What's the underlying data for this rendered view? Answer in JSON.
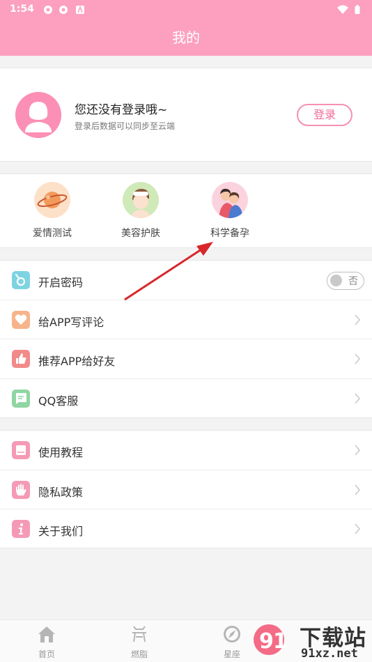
{
  "status": {
    "time": "1:54"
  },
  "header": {
    "title": "我的"
  },
  "profile": {
    "title": "您还没有登录哦~",
    "subtitle": "登录后数据可以同步至云端",
    "login_label": "登录"
  },
  "features": [
    {
      "label": "爱情测试",
      "icon": "planet-icon"
    },
    {
      "label": "美容护肤",
      "icon": "skincare-icon"
    },
    {
      "label": "科学备孕",
      "icon": "couple-icon"
    }
  ],
  "settings": {
    "password": {
      "label": "开启密码",
      "toggle_text": "否",
      "enabled": false
    },
    "review": {
      "label": "给APP写评论"
    },
    "recommend": {
      "label": "推荐APP给好友"
    },
    "qq": {
      "label": "QQ客服"
    },
    "tutorial": {
      "label": "使用教程"
    },
    "privacy": {
      "label": "隐私政策"
    },
    "about": {
      "label": "关于我们"
    }
  },
  "tabs": [
    {
      "label": "首页",
      "icon": "home-icon"
    },
    {
      "label": "燃脂",
      "icon": "fitness-icon"
    },
    {
      "label": "星座",
      "icon": "compass-icon"
    }
  ],
  "watermark": {
    "brand": "下载站",
    "url": "91xz.net"
  },
  "colors": {
    "accent": "#fd9fbf",
    "login_text": "#f06d98",
    "icon_blue": "#7dd3e2",
    "icon_orange": "#f7b48a",
    "icon_red": "#f28a8a",
    "icon_green": "#8fd6a2",
    "icon_pink": "#f59ab6"
  }
}
